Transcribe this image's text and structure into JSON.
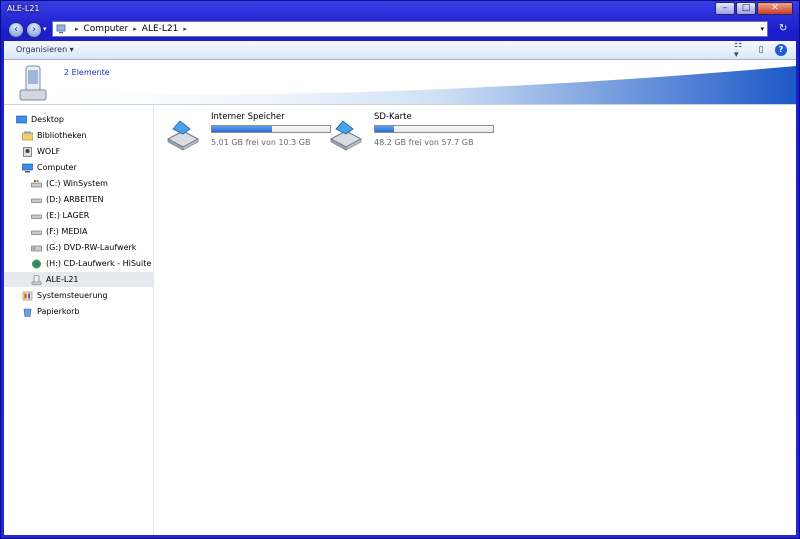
{
  "window": {
    "title": "ALE-L21"
  },
  "caption": {
    "minimize": "–",
    "maximize": "□",
    "close": "✕"
  },
  "nav_buttons": {
    "back": "‹",
    "forward": "›",
    "recent": "▾"
  },
  "address": {
    "segments": [
      "Computer",
      "ALE-L21"
    ],
    "separator": "▸",
    "dropdown": "▾",
    "refresh": "↻"
  },
  "toolbar": {
    "organize_label": "Organisieren ▾",
    "views": "☷ ▾",
    "pane": "▯",
    "help": "?"
  },
  "details": {
    "item_count": "2 Elemente"
  },
  "nav": {
    "items": [
      {
        "label": "Desktop",
        "icon": "desktop-icon",
        "selected": false
      },
      {
        "label": "Bibliotheken",
        "icon": "libraries-icon",
        "selected": false
      },
      {
        "label": "WOLF",
        "icon": "user-icon",
        "selected": false
      },
      {
        "label": "Computer",
        "icon": "computer-icon",
        "selected": false
      },
      {
        "label": "(C:) WinSystem",
        "icon": "system-drive-icon",
        "selected": false
      },
      {
        "label": "(D:) ARBEITEN",
        "icon": "drive-icon",
        "selected": false
      },
      {
        "label": "(E:) LAGER",
        "icon": "drive-icon",
        "selected": false
      },
      {
        "label": "(F:) MEDIA",
        "icon": "drive-icon",
        "selected": false
      },
      {
        "label": "(G:) DVD-RW-Laufwerk",
        "icon": "dvd-drive-icon",
        "selected": false
      },
      {
        "label": "(H:) CD-Laufwerk - HiSuite",
        "icon": "hisuite-cd-icon",
        "selected": false
      },
      {
        "label": "ALE-L21",
        "icon": "phone-icon",
        "selected": true
      },
      {
        "label": "Systemsteuerung",
        "icon": "control-panel-icon",
        "selected": false
      },
      {
        "label": "Papierkorb",
        "icon": "recycle-bin-icon",
        "selected": false
      }
    ]
  },
  "drives": [
    {
      "name": "Interner Speicher",
      "free_text": "5.01 GB frei von 10.3 GB",
      "used_fraction": 0.51
    },
    {
      "name": "SD-Karte",
      "free_text": "48.2 GB frei von 57.7 GB",
      "used_fraction": 0.16
    }
  ],
  "colors": {
    "accent": "#2669d3",
    "selection": "#e6e9ee",
    "frame": "#2426d8"
  }
}
